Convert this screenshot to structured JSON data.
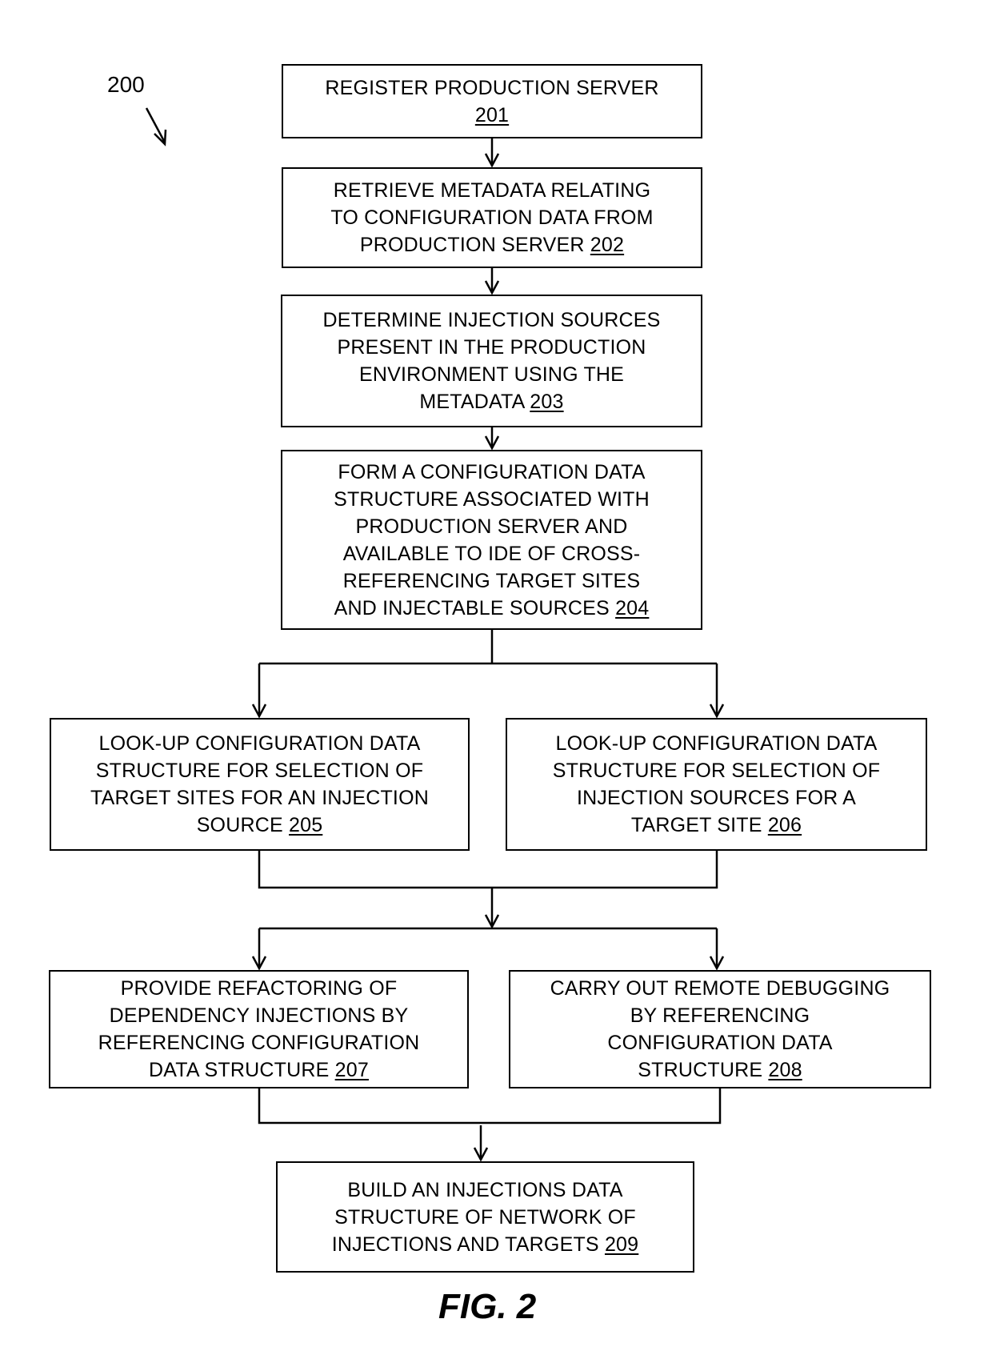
{
  "diagram": {
    "reference_number": "200",
    "figure_label": "FIG. 2",
    "steps": [
      {
        "id": "201",
        "lines": [
          "REGISTER  PRODUCTION SERVER"
        ],
        "ref": "201",
        "ref_on_own_line": true
      },
      {
        "id": "202",
        "lines": [
          "RETRIEVE METADATA RELATING",
          "TO CONFIGURATION DATA FROM",
          "PRODUCTION SERVER "
        ],
        "ref": "202"
      },
      {
        "id": "203",
        "lines": [
          "DETERMINE INJECTION SOURCES",
          "PRESENT IN THE PRODUCTION",
          "ENVIRONMENT USING THE",
          "METADATA "
        ],
        "ref": "203"
      },
      {
        "id": "204",
        "lines": [
          "FORM A CONFIGURATION DATA",
          "STRUCTURE ASSOCIATED WITH",
          "PRODUCTION SERVER AND",
          "AVAILABLE TO IDE  OF CROSS-",
          "REFERENCING TARGET SITES",
          "AND INJECTABLE SOURCES "
        ],
        "ref": "204"
      },
      {
        "id": "205",
        "lines": [
          "LOOK-UP CONFIGURATION DATA",
          "STRUCTURE FOR SELECTION OF",
          "TARGET SITES FOR AN INJECTION",
          "SOURCE "
        ],
        "ref": "205"
      },
      {
        "id": "206",
        "lines": [
          "LOOK-UP CONFIGURATION DATA",
          "STRUCTURE FOR SELECTION OF",
          "INJECTION SOURCES FOR A",
          "TARGET SITE "
        ],
        "ref": "206"
      },
      {
        "id": "207",
        "lines": [
          "PROVIDE REFACTORING OF",
          "DEPENDENCY INJECTIONS BY",
          "REFERENCING CONFIGURATION",
          "DATA STRUCTURE "
        ],
        "ref": "207"
      },
      {
        "id": "208",
        "lines": [
          "CARRY OUT REMOTE DEBUGGING",
          "BY REFERENCING",
          "CONFIGURATION DATA",
          "STRUCTURE "
        ],
        "ref": "208"
      },
      {
        "id": "209",
        "lines": [
          "BUILD AN INJECTIONS DATA",
          "STRUCTURE OF NETWORK OF",
          "INJECTIONS AND TARGETS "
        ],
        "ref": "209"
      }
    ],
    "connections": [
      {
        "from": "201",
        "to": "202"
      },
      {
        "from": "202",
        "to": "203"
      },
      {
        "from": "203",
        "to": "204"
      },
      {
        "from": "204",
        "to": "205"
      },
      {
        "from": "204",
        "to": "206"
      },
      {
        "from": "205",
        "to": "207"
      },
      {
        "from": "205",
        "to": "208"
      },
      {
        "from": "206",
        "to": "207"
      },
      {
        "from": "206",
        "to": "208"
      },
      {
        "from": "207",
        "to": "209"
      },
      {
        "from": "208",
        "to": "209"
      }
    ]
  }
}
